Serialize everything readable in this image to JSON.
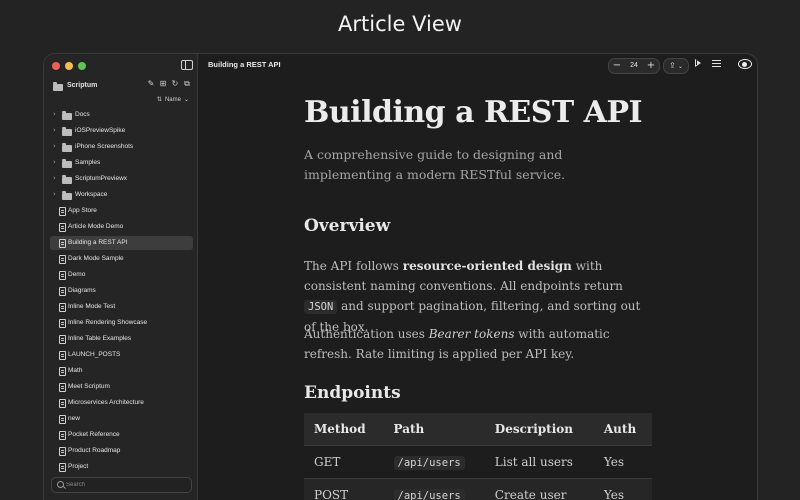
{
  "page_heading": "Article View",
  "sidebar": {
    "project_name": "Scriptum",
    "sort_label": "Name",
    "folders": [
      "Docs",
      "iOSPreviewSpike",
      "iPhone Screenshots",
      "Samples",
      "ScriptumPreviewx",
      "Workspace"
    ],
    "files": [
      "App Store",
      "Article Mode Demo",
      "Building a REST API",
      "Dark Mode Sample",
      "Demo",
      "Diagrams",
      "Inline Mode Test",
      "Inline Rendering Showcase",
      "Inline Table Examples",
      "LAUNCH_POSTS",
      "Math",
      "Meet Scriptum",
      "Microservices Architecture",
      "new",
      "Pocket Reference",
      "Product Roadmap",
      "Project"
    ],
    "selected_file": "Building a REST API",
    "search_placeholder": "Search"
  },
  "toolbar": {
    "document_title": "Building a REST API",
    "zoom_value": "24"
  },
  "article": {
    "title": "Building a REST API",
    "lead": "A comprehensive guide to designing and implementing a modern RESTful service.",
    "overview_heading": "Overview",
    "p1_a": "The API follows ",
    "p1_bold": "resource-oriented design",
    "p1_b": " with consistent naming conventions. All endpoints return ",
    "p1_code": "JSON",
    "p1_c": " and support pagination, filtering, and sorting out of the box.",
    "p2_a": "Authentication uses ",
    "p2_italic": "Bearer tokens",
    "p2_b": " with automatic refresh. Rate limiting is applied per API key.",
    "endpoints_heading": "Endpoints",
    "table_headers": [
      "Method",
      "Path",
      "Description",
      "Auth"
    ],
    "table_rows": [
      [
        "GET",
        "/api/users",
        "List all users",
        "Yes"
      ],
      [
        "POST",
        "/api/users",
        "Create user",
        "Yes"
      ]
    ]
  }
}
